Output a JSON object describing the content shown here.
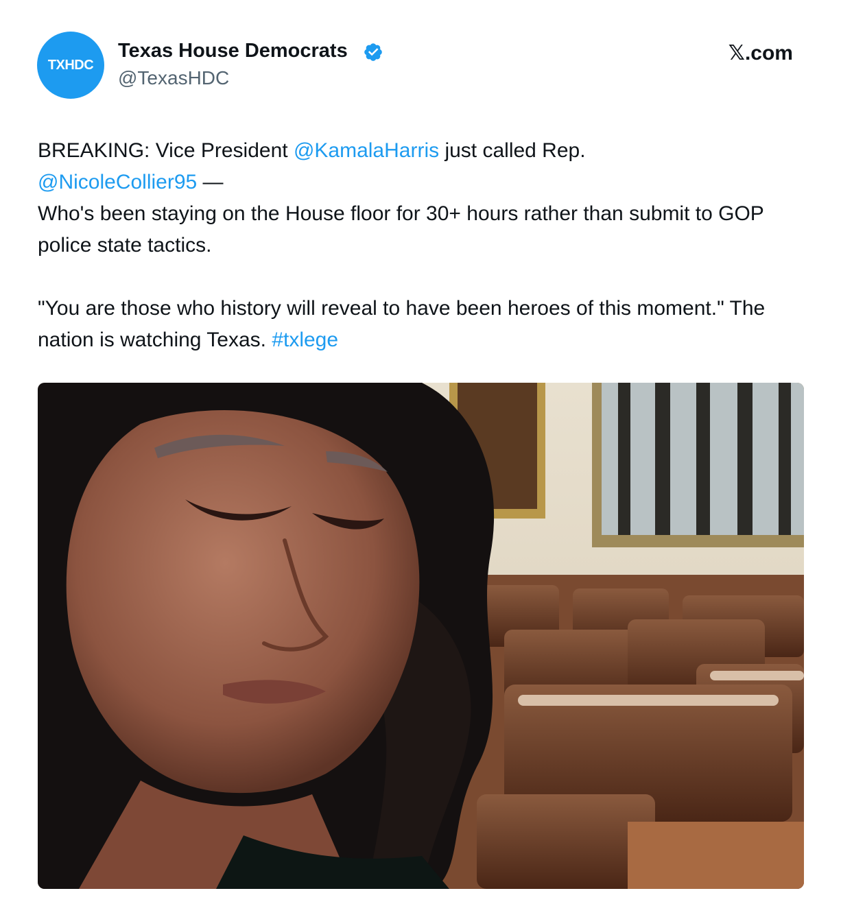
{
  "author": {
    "display_name": "Texas House Democrats",
    "handle": "@TexasHDC",
    "avatar_text": "TXHDC",
    "verified": true
  },
  "source": {
    "label": "𝕏.com"
  },
  "tweet": {
    "p1": {
      "t1": "BREAKING: Vice President ",
      "mention1": "@KamalaHarris",
      "t2": " just called Rep.",
      "mention2": "@NicoleCollier95",
      "t3": " —",
      "t4": "Who's been staying on the House floor for 30+ hours rather than submit to GOP police state tactics."
    },
    "p2": {
      "t1": "\"You are those who history will reveal to have been heroes of this moment.\" The nation is watching Texas. ",
      "hashtag": "#txlege"
    }
  },
  "colors": {
    "link": "#1d9bf0",
    "text": "#0f1419",
    "secondary_text": "#536471",
    "verified_badge": "#1d9bf0"
  },
  "icons": {
    "verified": "verified-badge-icon",
    "avatar": "texas-state-logo"
  }
}
